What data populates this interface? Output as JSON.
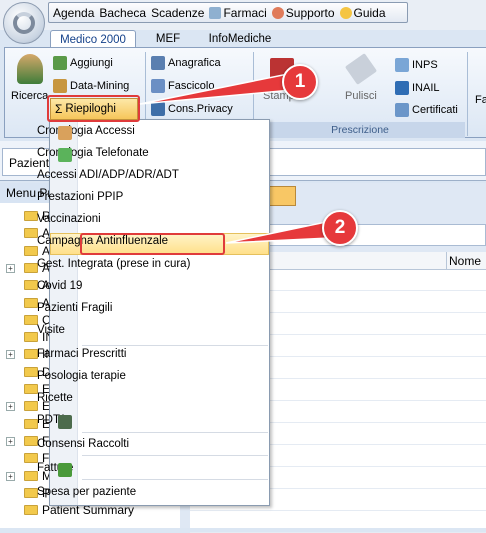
{
  "quick_access": {
    "items": [
      "Agenda",
      "Bacheca",
      "Scadenze",
      "Farmaci",
      "Supporto",
      "Guida"
    ]
  },
  "tabs": [
    "Medico 2000",
    "MEF",
    "InfoMediche"
  ],
  "ribbon": {
    "ricerca": "Ricerca",
    "aggiungi": "Aggiungi",
    "data_mining": "Data-Mining",
    "riepiloghi": "Riepiloghi",
    "anagrafica": "Anagrafica",
    "fascicolo": "Fascicolo",
    "cons_privacy": "Cons.Privacy",
    "stampa": "Stampa",
    "pulisci": "Pulisci",
    "inps": "INPS",
    "inail": "INAIL",
    "certificati": "Certificati",
    "group_prescrizione": "Prescrizione",
    "far": "Fa"
  },
  "patient_bar": {
    "label": "Pazient"
  },
  "left_panel": {
    "header": "Menu Pr",
    "tree": [
      "R",
      "A",
      "A",
      "A",
      "A",
      "A",
      "C",
      "IN",
      "IN",
      "D",
      "E",
      "E",
      "E",
      "F",
      "F",
      "M",
      "P",
      "Patient Summary"
    ]
  },
  "grid": {
    "tab_label": "ente",
    "column_name": "Nome",
    "filter_text": "ri"
  },
  "menu": {
    "items": [
      "Cronologia Accessi",
      "Cronologia Telefonate",
      "Accessi ADI/ADP/ADR/ADT",
      "Prestazioni PPIP",
      "Vaccinazioni",
      "Campagna Antinfluenzale",
      "Gest. Integrata (prese in cura)",
      "Covid 19",
      "Pazienti Fragili",
      "Visite",
      "Farmaci Prescritti",
      "Posologia terapie",
      "Ricette",
      "PDTA",
      "Consensi Raccolti",
      "Fatture",
      "Spesa per paziente"
    ]
  },
  "callouts": [
    "1",
    "2"
  ],
  "colors": {
    "callout": "#e6393b",
    "highlight": "#f6c65b"
  }
}
